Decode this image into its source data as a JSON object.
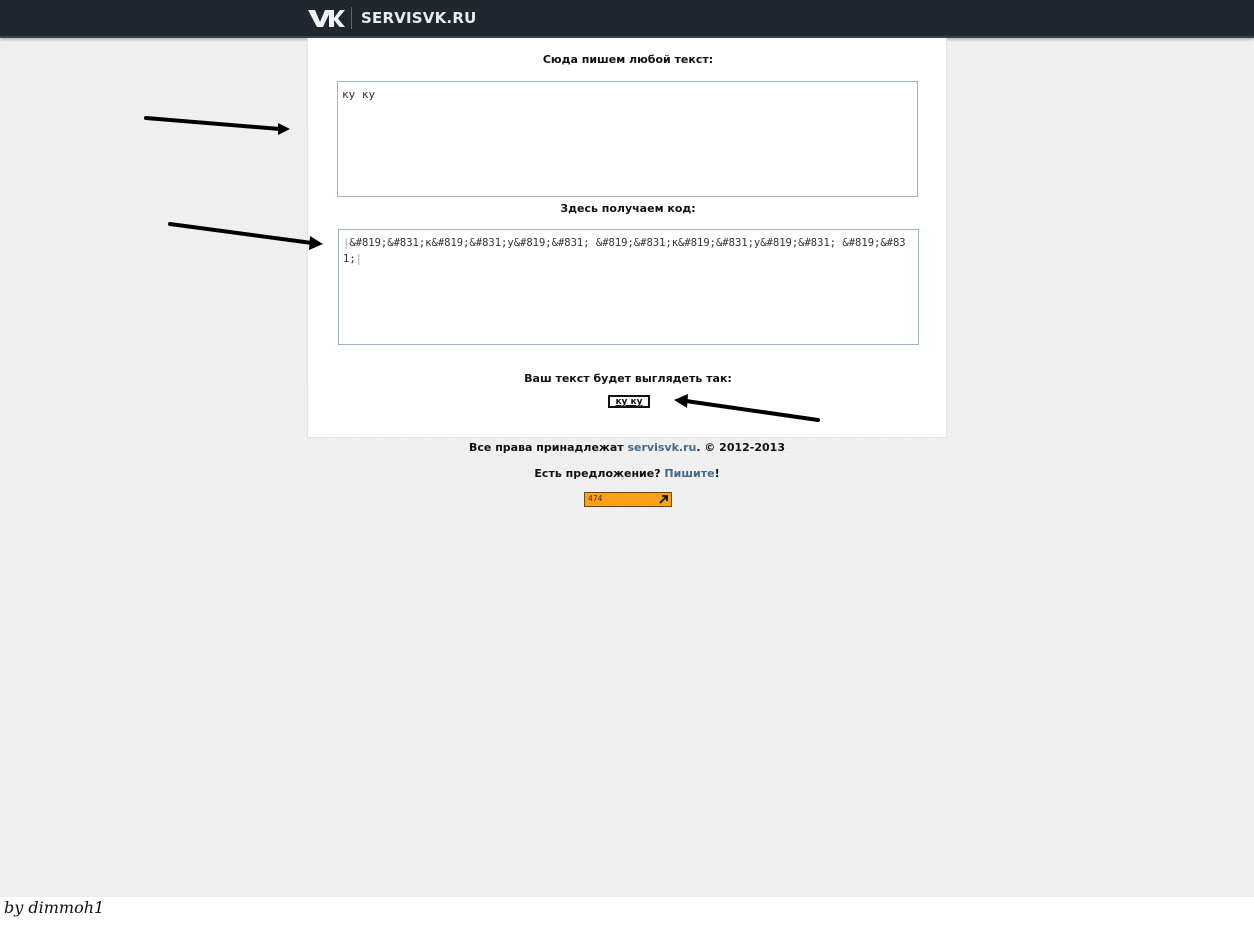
{
  "header": {
    "logo_text": "SERVISVK.RU",
    "logo_icon": "vk-icon"
  },
  "form": {
    "input_label": "Сюда пишем любой текст:",
    "input_value": "ку ку",
    "output_label": "Здесь получаем код:",
    "output_value": "&#819;&#831;к&#819;&#831;у&#819;&#831; &#819;&#831;к&#819;&#831;у&#819;&#831; &#819;&#831;",
    "preview_label": "Ваш текст будет выглядеть так:",
    "preview_value": "ку ку"
  },
  "footer": {
    "rights_prefix": "Все права принадлежат ",
    "rights_link": "servisvk.ru",
    "rights_suffix": ". © 2012-2013",
    "suggest_prefix": "Есть предложение? ",
    "suggest_link": "Пишите",
    "suggest_suffix": "!"
  },
  "counter": {
    "value": "474",
    "icon": "arrow-up-right-icon"
  },
  "annotations": {
    "arrow_icon": "hand-drawn-arrow-icon",
    "signature": "by dimmoh1"
  },
  "colors": {
    "topbar": "#20272f",
    "link": "#45688e",
    "counter_bg": "#f7a11d",
    "textbox_border": "#9db3c8"
  }
}
